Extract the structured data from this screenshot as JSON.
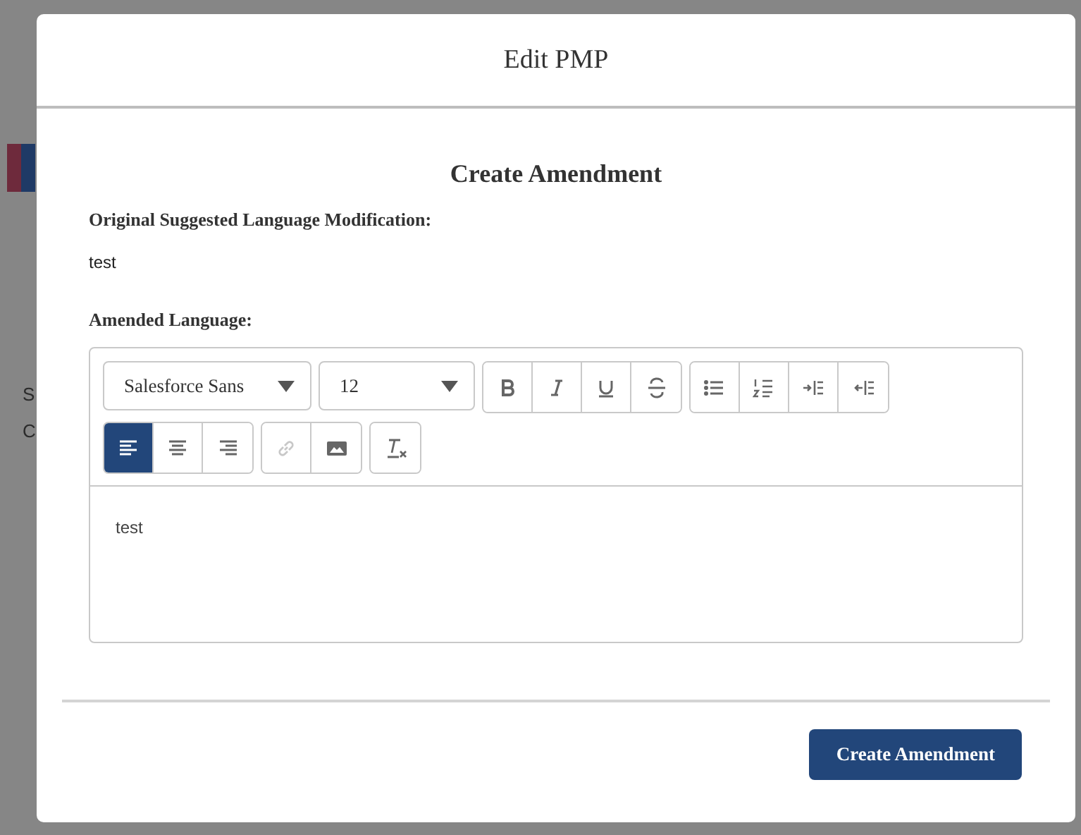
{
  "background": {
    "fragments": [
      {
        "text": "S"
      },
      {
        "text": "C"
      }
    ]
  },
  "modal": {
    "title": "Edit PMP",
    "heading": "Create Amendment",
    "original_label": "Original Suggested Language Modification:",
    "original_value": "test",
    "amended_label": "Amended Language:",
    "editor": {
      "font": "Salesforce Sans",
      "size": "12",
      "groups": [
        [
          {
            "kind": "bold",
            "selected": false,
            "disabled": false
          },
          {
            "kind": "italic",
            "selected": false,
            "disabled": false
          },
          {
            "kind": "underline",
            "selected": false,
            "disabled": false
          },
          {
            "kind": "strike",
            "selected": false,
            "disabled": false
          }
        ],
        [
          {
            "kind": "bullets",
            "selected": false,
            "disabled": false
          },
          {
            "kind": "numbers",
            "selected": false,
            "disabled": false
          },
          {
            "kind": "indent",
            "selected": false,
            "disabled": false
          },
          {
            "kind": "outdent",
            "selected": false,
            "disabled": false
          }
        ],
        [
          {
            "kind": "align-left",
            "selected": true,
            "disabled": false
          },
          {
            "kind": "align-center",
            "selected": false,
            "disabled": false
          },
          {
            "kind": "align-right",
            "selected": false,
            "disabled": false
          }
        ],
        [
          {
            "kind": "link",
            "selected": false,
            "disabled": true
          },
          {
            "kind": "image",
            "selected": false,
            "disabled": false
          }
        ],
        [
          {
            "kind": "clear",
            "selected": false,
            "disabled": false
          }
        ]
      ],
      "value": "test"
    },
    "button": "Create Amendment"
  }
}
